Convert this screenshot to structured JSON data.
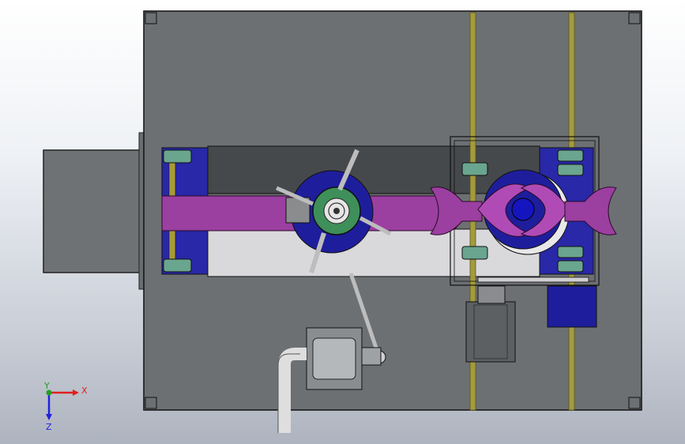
{
  "view": {
    "background_top": "#ffffff",
    "background_bottom": "#aeb4bf"
  },
  "colors": {
    "frame": "#6b6f73",
    "frame_edge": "#2a2a2a",
    "inner_panel": "#6d7073",
    "purple": "#9b3fa0",
    "blue": "#2020a6",
    "light_gray": "#d8d8da",
    "dark_gray": "#4a4d50",
    "green_bearing": "#6aa58f",
    "rod": "#8f8a3a",
    "motor": "#5b5e61"
  },
  "triad": {
    "x_label": "X",
    "y_label": "Y",
    "z_label": "Z",
    "x_color": "#e02020",
    "y_color": "#20a020",
    "z_color": "#2020e0"
  }
}
